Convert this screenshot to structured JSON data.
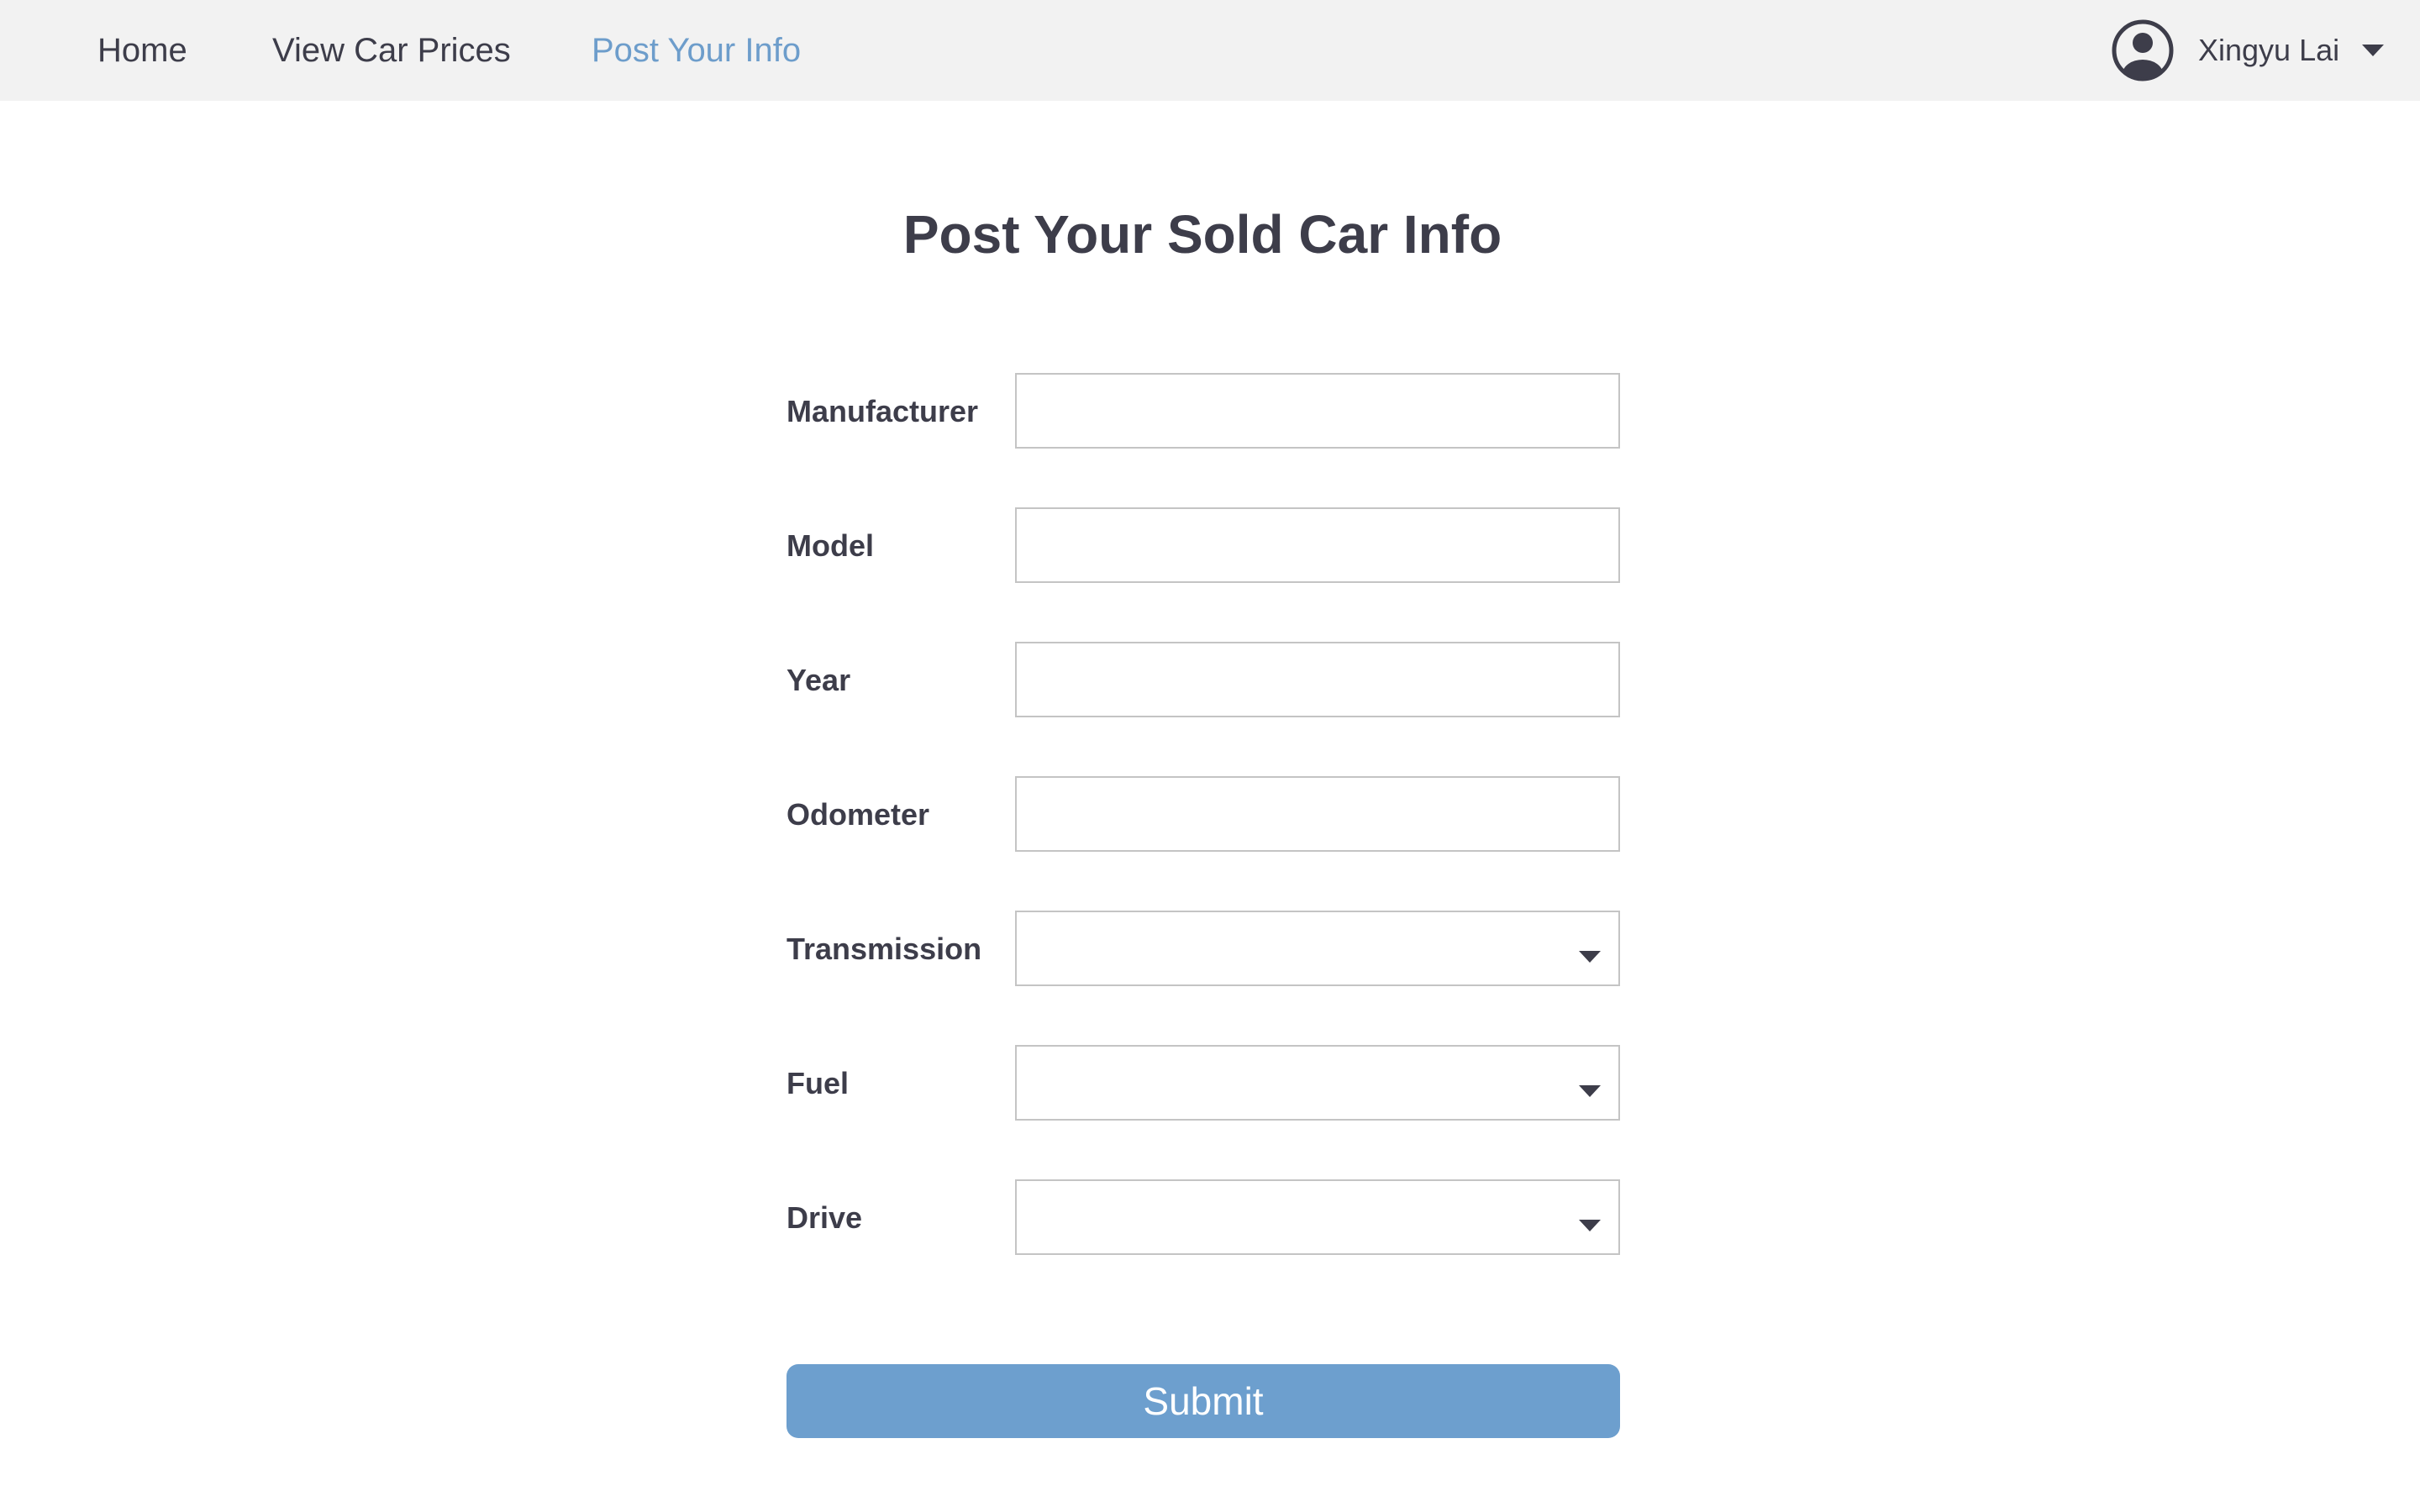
{
  "nav": {
    "items": [
      {
        "label": "Home",
        "active": false
      },
      {
        "label": "View Car Prices",
        "active": false
      },
      {
        "label": "Post Your Info",
        "active": true
      }
    ],
    "user": {
      "name": "Xingyu Lai",
      "icon": "user-circle-icon",
      "menu_icon": "caret-down-icon"
    }
  },
  "page": {
    "title": "Post Your Sold Car Info"
  },
  "form": {
    "fields": [
      {
        "label": "Manufacturer",
        "type": "text",
        "value": "",
        "placeholder": ""
      },
      {
        "label": "Model",
        "type": "text",
        "value": "",
        "placeholder": ""
      },
      {
        "label": "Year",
        "type": "text",
        "value": "",
        "placeholder": ""
      },
      {
        "label": "Odometer",
        "type": "text",
        "value": "",
        "placeholder": ""
      },
      {
        "label": "Transmission",
        "type": "select",
        "value": ""
      },
      {
        "label": "Fuel",
        "type": "select",
        "value": ""
      },
      {
        "label": "Drive",
        "type": "select",
        "value": ""
      }
    ],
    "submit_label": "Submit"
  },
  "colors": {
    "accent": "#6d9dcb",
    "submit_bg": "#6d9fce",
    "text": "#3d3d4a",
    "nav_bg": "#f2f2f2",
    "field_border": "#c4c4c4"
  }
}
